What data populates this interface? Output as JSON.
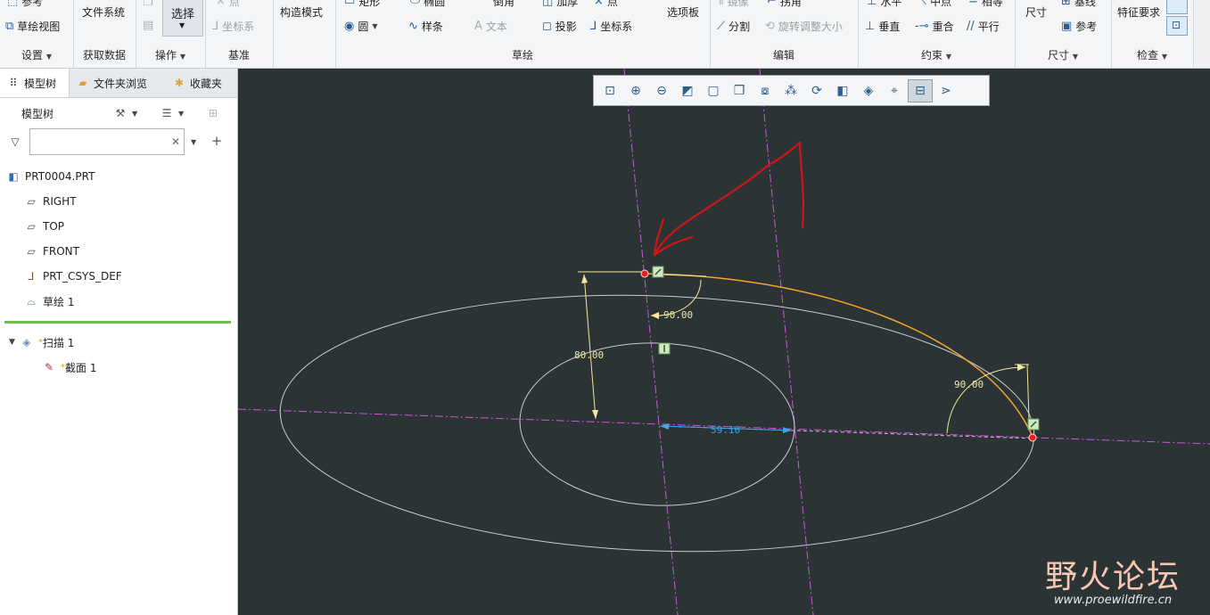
{
  "ribbon": {
    "groups": {
      "settings": "设置",
      "get_data": "获取数据",
      "operations": "操作",
      "datum": "基准",
      "sketch": "草绘",
      "edit": "编辑",
      "constrain": "约束",
      "dimension": "尺寸",
      "inspect": "检查"
    },
    "reference_label": "参考",
    "sketch_view_label": "草绘视图",
    "file_system_label": "文件系统",
    "select_label": "选择",
    "point_label": "点",
    "csys_label": "坐标系",
    "construction_mode_label": "构造模式",
    "rectangle_label": "矩形",
    "ellipse_label": "椭圆",
    "fillet_label": "倒角",
    "thicken_label": "加厚",
    "point2_label": "点",
    "circle_label": "圆",
    "spline_label": "样条",
    "text_label": "文本",
    "project_label": "投影",
    "csys2_label": "坐标系",
    "palette_label": "选项板",
    "mirror_label": "镜像",
    "trim_label": "拐角",
    "divide_label": "分割",
    "rotate_resize_label": "旋转调整大小",
    "horizontal_label": "水平",
    "midpoint_label": "中点",
    "tangent_label": "相等",
    "vertical_label": "垂直",
    "coincident_label": "重合",
    "parallel_label": "平行",
    "dimension_label": "尺寸",
    "baseline_label": "基线",
    "ref_label": "参考",
    "feature_req_label": "特征要求"
  },
  "left_panel": {
    "tabs": [
      "模型树",
      "文件夹浏览",
      "收藏夹"
    ],
    "header_label": "模型树",
    "search": {
      "value": "",
      "placeholder": ""
    },
    "tree": {
      "part": "PRT0004.PRT",
      "right": "RIGHT",
      "top": "TOP",
      "front": "FRONT",
      "csys": "PRT_CSYS_DEF",
      "sketch": "草绘 1",
      "sweep": "扫描 1",
      "section": "截面 1"
    }
  },
  "sketch": {
    "dim_height": "80.00",
    "dim_angle_top": "90.00",
    "dim_angle_right": "90.00",
    "dim_width": "59.10",
    "colors": {
      "background": "#2c3335",
      "geometry": "#c8cccf",
      "dimension": "#f2e8a0",
      "highlight": "#f2a531",
      "centerline": "#c45bd6",
      "annotation": "#d21414",
      "selected_dim": "#3aa7e8"
    }
  },
  "watermark": {
    "text": "野火论坛",
    "url": "www.proewildfire.cn"
  }
}
